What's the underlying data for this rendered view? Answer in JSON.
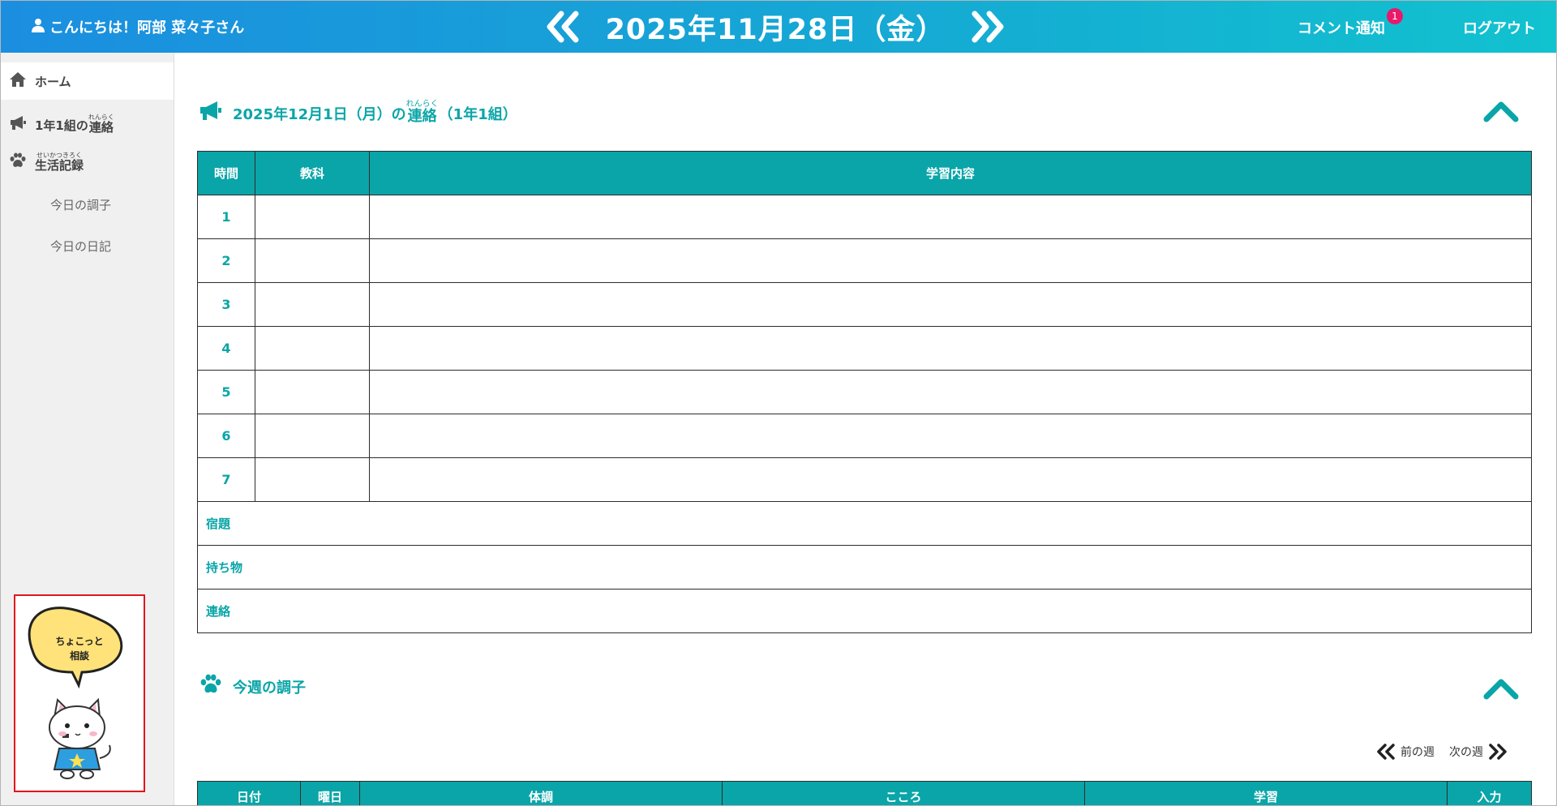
{
  "header": {
    "greeting": "こんにちは！阿部 菜々子さん",
    "date": "2025年11月28日（金）",
    "notify_label": "コメント通知",
    "notify_count": "1",
    "logout_label": "ログアウト"
  },
  "sidebar": {
    "home": "ホーム",
    "contact_prefix": "1年1組の",
    "contact_kanji": "連絡",
    "contact_ruby": "れんらく",
    "life_kanji": "生活記録",
    "life_ruby": "せいかつきろく",
    "sub_items": [
      "今日の調子",
      "今日の日記"
    ],
    "consult_line1": "ちょこっと",
    "consult_line2": "相談"
  },
  "contact_section": {
    "title_prefix": "2025年12月1日（月）の",
    "title_kanji": "連絡",
    "title_ruby": "れんらく",
    "title_suffix": "（1年1組）",
    "headers": [
      "時間",
      "教科",
      "学習内容"
    ],
    "periods": [
      "1",
      "2",
      "3",
      "4",
      "5",
      "6",
      "7"
    ],
    "extra_rows": [
      "宿題",
      "持ち物",
      "連絡"
    ]
  },
  "week_section": {
    "title": "今週の調子",
    "prev_week": "前の週",
    "next_week": "次の週",
    "headers": [
      "日付",
      "曜日",
      "体調",
      "こころ",
      "学習",
      "入力"
    ]
  },
  "colors": {
    "accent": "#0aa5a8",
    "header_gradient_start": "#1b8ee0",
    "header_gradient_end": "#11c2cf",
    "badge": "#e8196a",
    "consult_border": "#e1161e"
  }
}
